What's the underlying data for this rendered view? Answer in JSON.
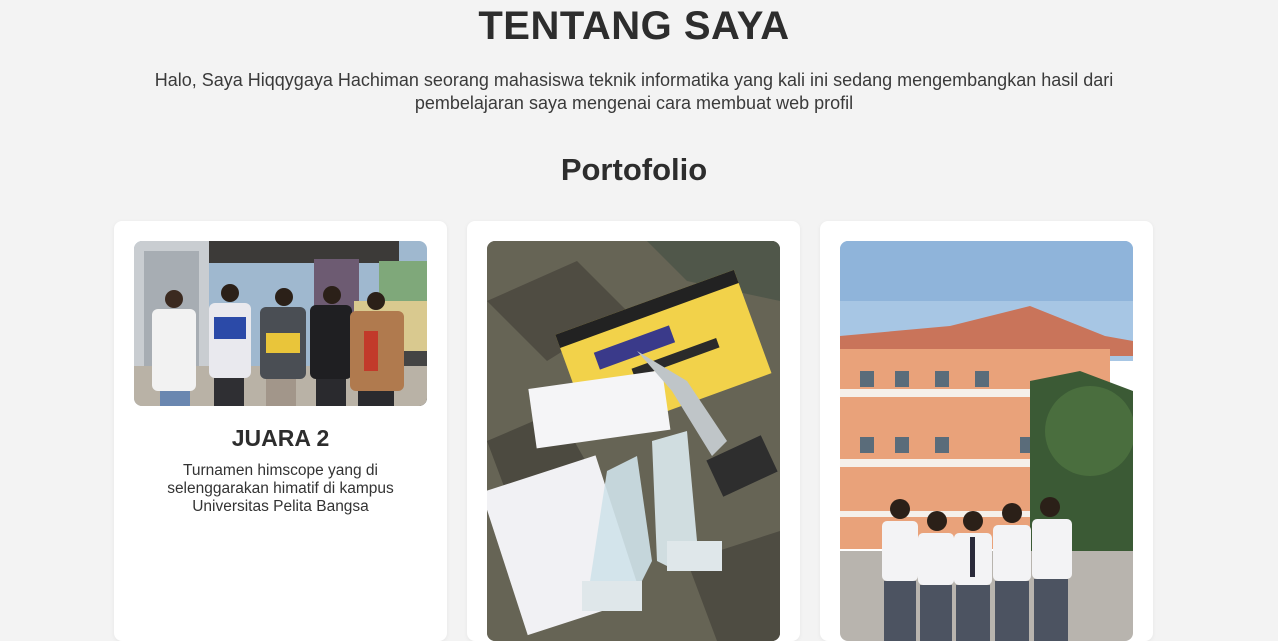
{
  "about": {
    "title": "TENTANG SAYA",
    "text": "Halo, Saya Hiqqygaya Hachiman seorang mahasiswa teknik informatika yang kali ini sedang mengembangkan hasil dari pembelajaran saya mengenai cara membuat web profil"
  },
  "portfolio": {
    "title": "Portofolio",
    "cards": [
      {
        "title": "JUARA 2",
        "description": "Turnamen himscope yang di selenggarakan himatif di kampus Universitas Pelita Bangsa"
      },
      {
        "title": "",
        "description": ""
      },
      {
        "title": "",
        "description": ""
      }
    ]
  }
}
